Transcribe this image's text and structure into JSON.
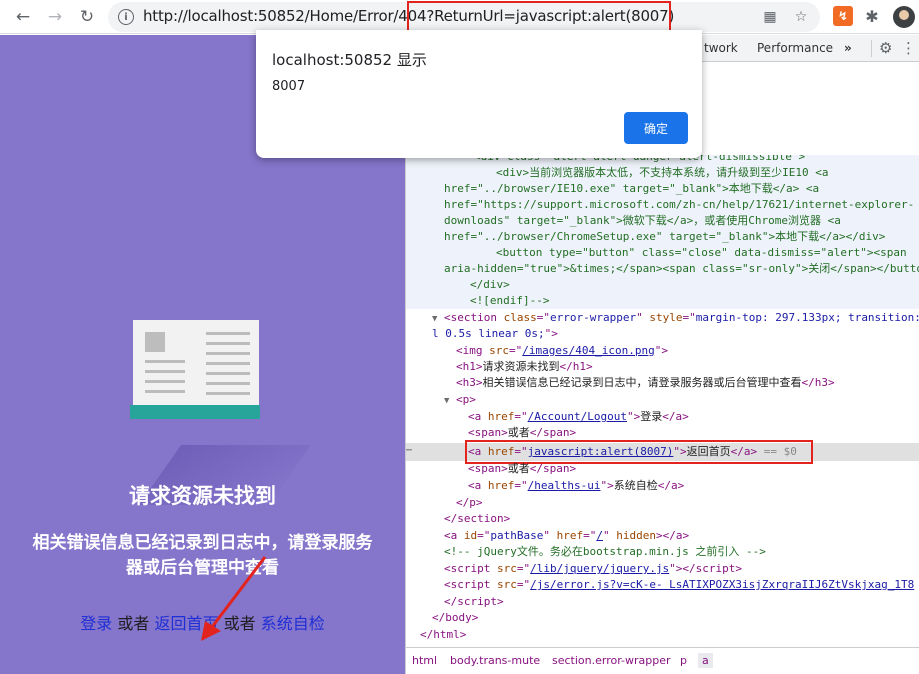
{
  "browser": {
    "url_host": "http://localhost:50852",
    "url_path": "/Home/Error/404",
    "url_query": "?ReturnUrl=javascript:alert(8007)"
  },
  "page": {
    "title": "请求资源未找到",
    "description": "相关错误信息已经记录到日志中，请登录服务器或后台管理中查看",
    "links": {
      "login": "登录",
      "or1": "或者",
      "home": "返回首页",
      "or2": "或者",
      "health": "系统自检"
    }
  },
  "dialog": {
    "title": "localhost:50852 显示",
    "message": "8007",
    "ok_label": "确定"
  },
  "devtools": {
    "tabs": [
      "twork",
      "Performance"
    ],
    "code_lines": [
      {
        "t": "<div class=\"alert alert-danger alert-dismissible\">"
      },
      {
        "t": "<div>当前浏览器版本太低，不支持本系统，请升级到至少IE10 <a"
      },
      {
        "t": "href=\"../browser/IE10.exe\" target=\"_blank\">本地下载</a> <a"
      },
      {
        "t": "href=\"https://support.microsoft.com/zh-cn/help/17621/internet-explorer-"
      },
      {
        "t": "downloads\" target=\"_blank\">微软下载</a>，或者使用Chrome浏览器 <a"
      },
      {
        "t": "href=\"../browser/ChromeSetup.exe\" target=\"_blank\">本地下载</a></div>"
      },
      {
        "t": "<button type=\"button\" class=\"close\" data-dismiss=\"alert\"><span"
      },
      {
        "t": "aria-hidden=\"true\">&times;</span><span class=\"sr-only\">关闭</span></butto"
      },
      {
        "t": "</div>"
      },
      {
        "t": "<![endif]-->"
      }
    ],
    "section_tag": "section",
    "section_class": "error-wrapper",
    "section_style": "margin-top: 297.133px; transition:",
    "section_style2": "l 0.5s linear 0s;",
    "img_src": "/images/404_icon.png",
    "h1_text": "请求资源未找到",
    "h3_text": "相关错误信息已经记录到日志中，请登录服务器或后台管理中查看",
    "logout_href": "/Account/Logout",
    "logout_text": "登录",
    "span1_text": "或者",
    "selected_href": "javascript:alert(8007)",
    "selected_text": "返回首页",
    "selected_suffix": "== $0",
    "span2_text": "或者",
    "health_href": "/healths-ui",
    "health_text": "系统自检",
    "pathbase_href": "/",
    "comment": "<!-- jQuery文件。务必在bootstrap.min.js 之前引入 -->",
    "jquery_src": "/lib/jquery/jquery.js",
    "error_src": "/js/error.js?v=cK-e- LsATIXPOZX3isjZxrqraIIJ6ZtVskjxag_1T8",
    "breadcrumbs": [
      "html",
      "body.trans-mute",
      "section.error-wrapper",
      "p",
      "a"
    ]
  }
}
